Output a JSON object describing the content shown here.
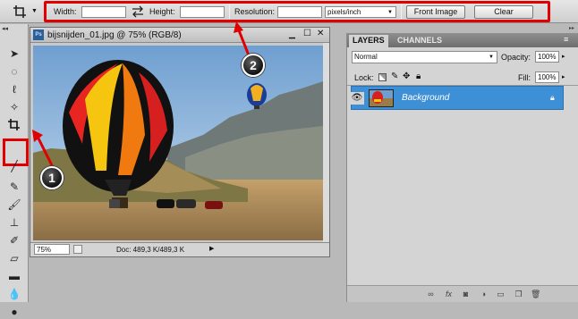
{
  "options_bar": {
    "width_label": "Width:",
    "width_value": "",
    "swap_icon": "swap-arrows-icon",
    "height_label": "Height:",
    "height_value": "",
    "resolution_label": "Resolution:",
    "resolution_value": "",
    "resolution_unit": "pixels/inch",
    "front_image_label": "Front Image",
    "clear_label": "Clear"
  },
  "document": {
    "title": "bijsnijden_01.jpg @ 75% (RGB/8)",
    "ps_badge": "Ps",
    "zoom": "75%",
    "doc_info": "Doc: 489,3 K/489,3 K"
  },
  "layers_panel": {
    "tab_layers": "LAYERS",
    "tab_channels": "CHANNELS",
    "blend_mode": "Normal",
    "opacity_label": "Opacity:",
    "opacity_value": "100%",
    "lock_label": "Lock:",
    "fill_label": "Fill:",
    "fill_value": "100%",
    "layer_name": "Background"
  },
  "callouts": {
    "one": "1",
    "two": "2"
  },
  "colors": {
    "highlight_red": "#e00000",
    "selected_layer": "#3d8fd6"
  }
}
